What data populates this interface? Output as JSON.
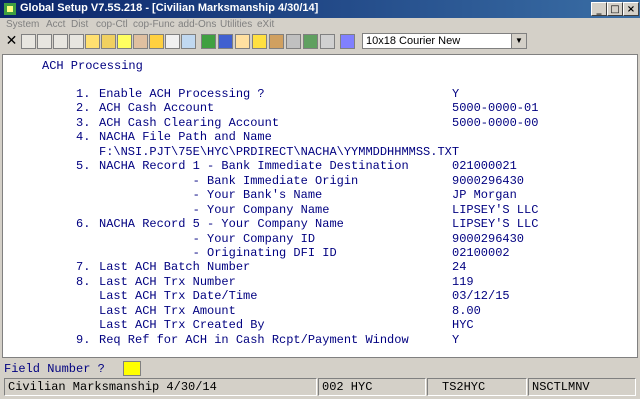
{
  "window": {
    "title": "Global Setup V7.5S.218 - [Civilian Marksmanship 4/30/14]"
  },
  "menu": [
    "System",
    "Acct",
    "Dist",
    "cop-Ctl",
    "cop-Func",
    "add-Ons",
    "Utilities",
    "eXit"
  ],
  "toolbar": {
    "font_select": "10x18 Courier New"
  },
  "screen": {
    "heading": "ACH Processing",
    "lines": [
      {
        "num": "1.",
        "label": "Enable ACH Processing ?",
        "value": "Y"
      },
      {
        "num": "2.",
        "label": "ACH Cash Account",
        "value": "5000-0000-01"
      },
      {
        "num": "3.",
        "label": "ACH Cash Clearing Account",
        "value": "5000-0000-00"
      },
      {
        "num": "4.",
        "label": "NACHA File Path and Name",
        "value": ""
      },
      {
        "num": "",
        "label": "F:\\NSI.PJT\\75E\\HYC\\PRDIRECT\\NACHA\\YYMMDDHHMMSS.TXT",
        "value": ""
      },
      {
        "num": "5.",
        "label": "NACHA Record 1 - Bank Immediate Destination",
        "value": "021000021"
      },
      {
        "num": "",
        "label": "             - Bank Immediate Origin",
        "value": "9000296430"
      },
      {
        "num": "",
        "label": "             - Your Bank's Name",
        "value": "JP Morgan"
      },
      {
        "num": "",
        "label": "             - Your Company Name",
        "value": "LIPSEY'S LLC"
      },
      {
        "num": "6.",
        "label": "NACHA Record 5 - Your Company Name",
        "value": "LIPSEY'S LLC"
      },
      {
        "num": "",
        "label": "             - Your Company ID",
        "value": "9000296430"
      },
      {
        "num": "",
        "label": "             - Originating DFI ID",
        "value": "02100002"
      },
      {
        "num": "7.",
        "label": "Last ACH Batch Number",
        "value": "24"
      },
      {
        "num": "8.",
        "label": "Last ACH Trx Number",
        "value": "119"
      },
      {
        "num": "",
        "label": "Last ACH Trx Date/Time",
        "value": "03/12/15"
      },
      {
        "num": "",
        "label": "Last ACH Trx Amount",
        "value": "8.00"
      },
      {
        "num": "",
        "label": "Last ACH Trx Created By",
        "value": "HYC"
      },
      {
        "num": "9.",
        "label": "Req Ref for ACH in Cash Rcpt/Payment Window",
        "value": "Y"
      }
    ]
  },
  "prompt": {
    "label": "Field Number ?",
    "value": ""
  },
  "statusbar": {
    "company": "Civilian Marksmanship 4/30/14",
    "user": "002 HYC",
    "station": "TS2HYC",
    "mode": "NSCTLMNV"
  },
  "colors": {
    "text": "#000080",
    "field_highlight": "#ffff00",
    "title_gradient_start": "#0a246a"
  }
}
